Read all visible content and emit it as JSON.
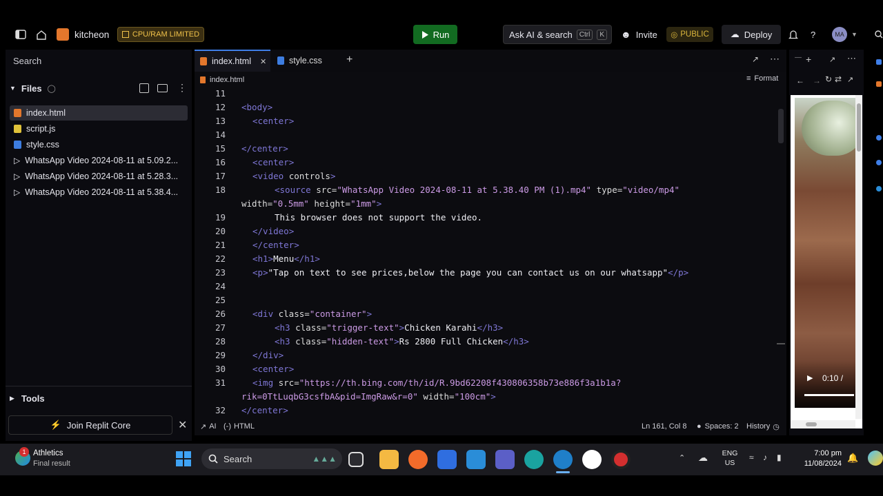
{
  "topbar": {
    "project_name": "kitcheon",
    "cpu_badge": "CPU/RAM LIMITED",
    "run_label": "Run",
    "ask_ai_label": "Ask AI & search",
    "shortcut_ctrl": "Ctrl",
    "shortcut_k": "K",
    "invite_label": "Invite",
    "public_label": "PUBLIC",
    "deploy_label": "Deploy",
    "help_label": "?",
    "avatar_initials": "MA"
  },
  "sidebar": {
    "search_placeholder": "Search",
    "files_label": "Files",
    "files": [
      {
        "name": "index.html",
        "icon": "html-file-icon"
      },
      {
        "name": "script.js",
        "icon": "js-file-icon"
      },
      {
        "name": "style.css",
        "icon": "css-file-icon"
      },
      {
        "name": "WhatsApp Video 2024-08-11 at 5.09.2...",
        "icon": "video-file-icon"
      },
      {
        "name": "WhatsApp Video 2024-08-11 at 5.28.3...",
        "icon": "video-file-icon"
      },
      {
        "name": "WhatsApp Video 2024-08-11 at 5.38.4...",
        "icon": "video-file-icon"
      }
    ],
    "tools_label": "Tools",
    "join_core_label": "Join Replit Core"
  },
  "editor": {
    "tabs": [
      {
        "label": "index.html",
        "active": true
      },
      {
        "label": "style.css",
        "active": false
      }
    ],
    "breadcrumb": "index.html",
    "format_label": "Format",
    "status": {
      "ai_label": "AI",
      "lang_label": "HTML",
      "position": "Ln 161, Col 8",
      "spaces": "Spaces: 2",
      "history": "History"
    },
    "line_numbers": [
      "11",
      "12",
      "13",
      "14",
      "15",
      "16",
      "17",
      "18",
      "19",
      "20",
      "21",
      "22",
      "23",
      "24",
      "25",
      "26",
      "27",
      "28",
      "29",
      "30",
      "31",
      "32"
    ],
    "code": {
      "l12": "body",
      "l13": "center",
      "l15": "/center",
      "l16": "center",
      "l17_tag": "video",
      "l17_attr": " controls",
      "l18_tag": "source",
      "l18_a1": " src=",
      "l18_v1": "\"WhatsApp Video 2024-08-11 at 5.38.40 PM (1).mp4\"",
      "l18_a2": " type=",
      "l18_v2": "\"video/mp4\"",
      "l18b_a1": "width=",
      "l18b_v1": "\"0.5mm\"",
      "l18b_a2": " height=",
      "l18b_v2": "\"1mm\"",
      "l19": "This browser does not support the video.",
      "l20": "/video",
      "l21": "/center",
      "l22_tag": "h1",
      "l22_text": "Menu",
      "l22_close": "/h1",
      "l23_tag": "p",
      "l23_text": "\"Tap on text to see prices,below the page you can contact us on our whatsapp\"",
      "l23_close": "/p",
      "l26_tag": "div",
      "l26_attr": " class=",
      "l26_val": "\"container\"",
      "l27_tag": "h3",
      "l27_attr": " class=",
      "l27_val": "\"trigger-text\"",
      "l27_text": "Chicken Karahi",
      "l27_close": "/h3",
      "l28_tag": "h3",
      "l28_attr": " class=",
      "l28_val": "\"hidden-text\"",
      "l28_text": "Rs 2800 Full Chicken",
      "l28_close": "/h3",
      "l29": "/div",
      "l30": "center",
      "l31_tag": "img",
      "l31_attr": " src=",
      "l31_val": "\"https://th.bing.com/th/id/R.9bd62208f430806358b73e886f3a1b1a?",
      "l31b_val": "rik=0TtLuqbG3csfbA&pid=ImgRaw&r=0\"",
      "l31b_attr": " width=",
      "l31b_val2": "\"100cm\"",
      "l32": "/center"
    }
  },
  "preview": {
    "video_time": "0:10 /"
  },
  "taskbar": {
    "widget_title": "Athletics",
    "widget_sub": "Final result",
    "widget_badge": "1",
    "search_label": "Search",
    "lang_top": "ENG",
    "lang_bottom": "US",
    "time": "7:00 pm",
    "date": "11/08/2024"
  }
}
